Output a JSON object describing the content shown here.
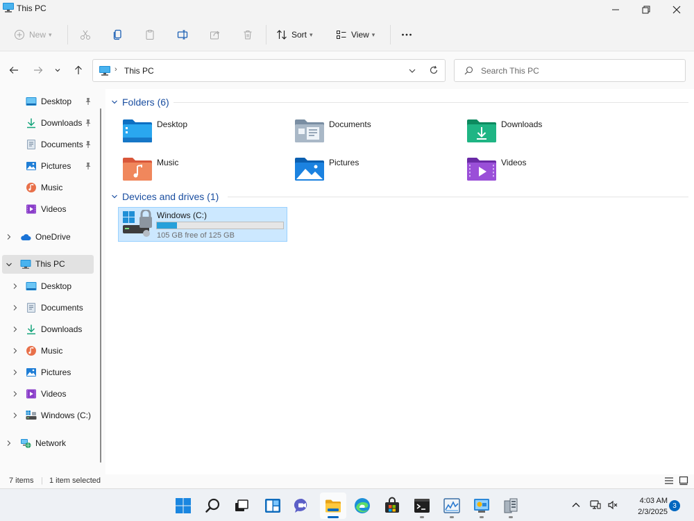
{
  "window": {
    "title": "This PC"
  },
  "toolbar": {
    "new_label": "New",
    "sort_label": "Sort",
    "view_label": "View"
  },
  "address": {
    "crumb": "This PC",
    "search_placeholder": "Search This PC"
  },
  "sidebar": {
    "quick_access": [
      {
        "label": "Desktop",
        "icon": "desktop-icon",
        "pinned": true
      },
      {
        "label": "Downloads",
        "icon": "downloads-icon",
        "pinned": true
      },
      {
        "label": "Documents",
        "icon": "documents-icon",
        "pinned": true
      },
      {
        "label": "Pictures",
        "icon": "pictures-icon",
        "pinned": true
      },
      {
        "label": "Music",
        "icon": "music-icon",
        "pinned": false
      },
      {
        "label": "Videos",
        "icon": "videos-icon",
        "pinned": false
      }
    ],
    "onedrive": "OneDrive",
    "thispc": "This PC",
    "thispc_children": [
      {
        "label": "Desktop",
        "icon": "desktop-icon"
      },
      {
        "label": "Documents",
        "icon": "documents-icon"
      },
      {
        "label": "Downloads",
        "icon": "downloads-icon"
      },
      {
        "label": "Music",
        "icon": "music-icon"
      },
      {
        "label": "Pictures",
        "icon": "pictures-icon"
      },
      {
        "label": "Videos",
        "icon": "videos-icon"
      },
      {
        "label": "Windows (C:)",
        "icon": "drive-icon"
      }
    ],
    "network": "Network"
  },
  "content": {
    "folders_header": "Folders (6)",
    "folders": [
      {
        "name": "Desktop",
        "icon": "desktop-folder-icon"
      },
      {
        "name": "Documents",
        "icon": "documents-folder-icon"
      },
      {
        "name": "Downloads",
        "icon": "downloads-folder-icon"
      },
      {
        "name": "Music",
        "icon": "music-folder-icon"
      },
      {
        "name": "Pictures",
        "icon": "pictures-folder-icon"
      },
      {
        "name": "Videos",
        "icon": "videos-folder-icon"
      }
    ],
    "drives_header": "Devices and drives (1)",
    "drive": {
      "name": "Windows (C:)",
      "free_text": "105 GB free of 125 GB",
      "free_gb": 105,
      "total_gb": 125,
      "used_fraction": 0.16
    }
  },
  "status": {
    "items": "7 items",
    "selected": "1 item selected"
  },
  "taskbar": {
    "time": "4:03 AM",
    "date": "2/3/2025",
    "notification_count": "3"
  },
  "colors": {
    "accent": "#0067c0",
    "group_header": "#1a4ea0",
    "selection": "#cce8ff",
    "drive_bar": "#26a0da"
  }
}
